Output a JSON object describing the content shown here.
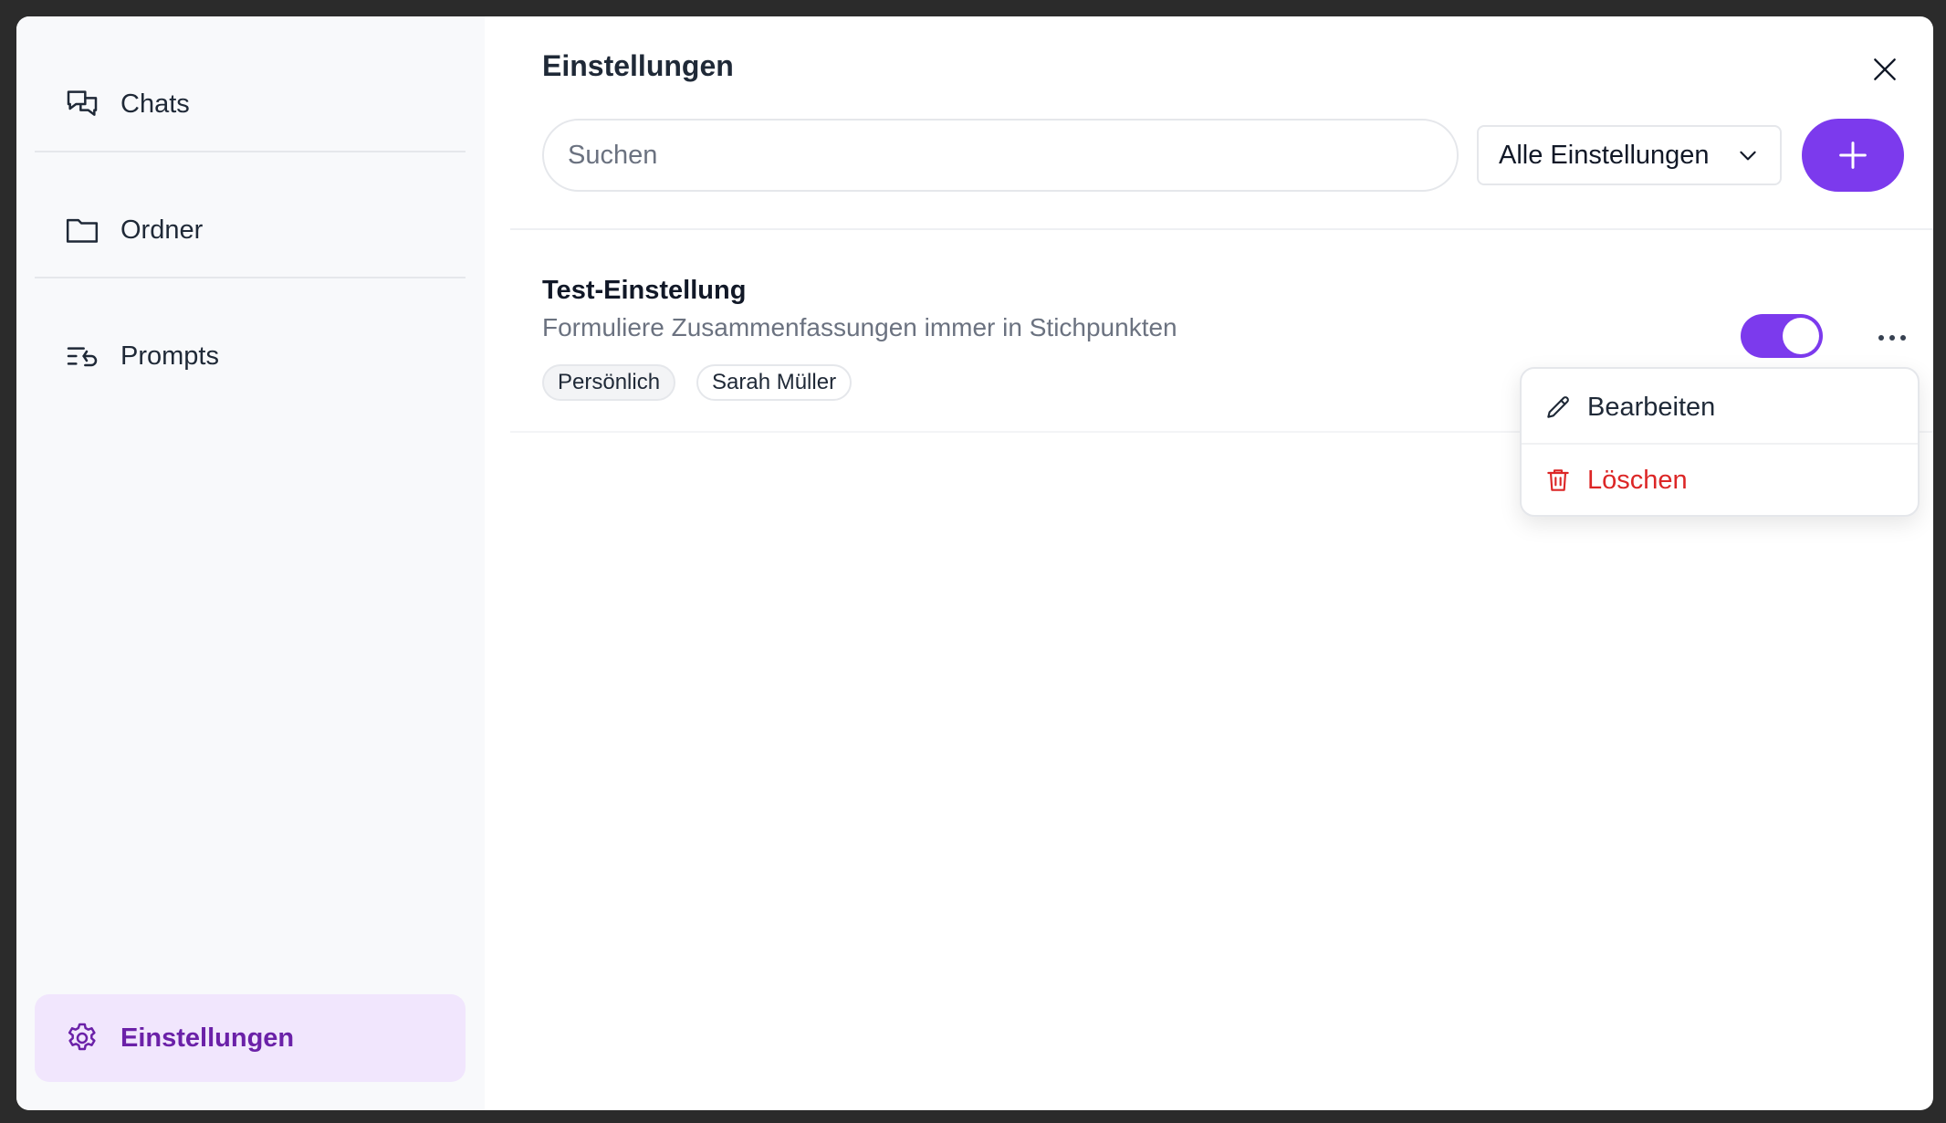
{
  "sidebar": {
    "items": [
      {
        "label": "Chats",
        "icon": "chats-icon"
      },
      {
        "label": "Ordner",
        "icon": "folder-icon"
      },
      {
        "label": "Prompts",
        "icon": "prompts-icon"
      }
    ],
    "active_item": {
      "label": "Einstellungen",
      "icon": "gear-icon"
    }
  },
  "header": {
    "title": "Einstellungen",
    "close_icon": "close-icon"
  },
  "toolbar": {
    "search_placeholder": "Suchen",
    "search_value": "",
    "filter_label": "Alle Einstellungen",
    "add_icon": "plus-icon"
  },
  "settings": [
    {
      "title": "Test-Einstellung",
      "description": "Formuliere Zusammenfassungen immer in Stichpunkten",
      "tags": [
        "Persönlich",
        "Sarah Müller"
      ],
      "enabled": true
    }
  ],
  "context_menu": {
    "items": [
      {
        "label": "Bearbeiten",
        "icon": "pencil-icon"
      },
      {
        "label": "Löschen",
        "icon": "trash-icon"
      }
    ]
  },
  "colors": {
    "accent": "#7c3aed",
    "active_nav_bg": "#f1e6fd",
    "active_nav_text": "#6b21a8",
    "danger": "#dc2626"
  }
}
